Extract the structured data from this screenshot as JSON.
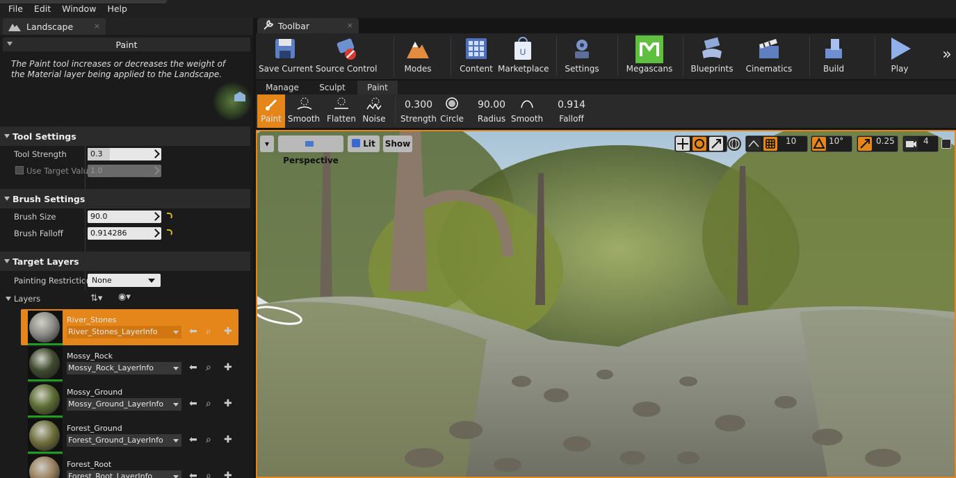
{
  "menu": {
    "items": [
      "File",
      "Edit",
      "Window",
      "Help"
    ]
  },
  "landscape_tab": {
    "label": "Landscape",
    "close": "×"
  },
  "paint_panel": {
    "title": "Paint",
    "description": "The Paint tool increases or decreases the weight of the Material layer being applied to the Landscape."
  },
  "tool_settings": {
    "title": "Tool Settings",
    "strength_label": "Tool Strength",
    "strength_value": "0.3",
    "strength_fraction": 0.3,
    "use_target_label": "Use Target Value",
    "use_target_value": "1.0"
  },
  "brush_settings": {
    "title": "Brush Settings",
    "size_label": "Brush Size",
    "size_value": "90.0",
    "falloff_label": "Brush Falloff",
    "falloff_value": "0.914286"
  },
  "target_layers": {
    "title": "Target Layers",
    "restriction_label": "Painting Restriction",
    "restriction_value": "None",
    "layers_label": "Layers",
    "layers": [
      {
        "name": "River_Stones",
        "info": "River_Stones_LayerInfo",
        "selected": true,
        "color": "#8c8c86"
      },
      {
        "name": "Mossy_Rock",
        "info": "Mossy_Rock_LayerInfo",
        "selected": false,
        "color": "#3f4a2e"
      },
      {
        "name": "Mossy_Ground",
        "info": "Mossy_Ground_LayerInfo",
        "selected": false,
        "color": "#5b6d33"
      },
      {
        "name": "Forest_Ground",
        "info": "Forest_Ground_LayerInfo",
        "selected": false,
        "color": "#6e6e3c"
      },
      {
        "name": "Forest_Root",
        "info": "Forest_Root_LayerInfo",
        "selected": false,
        "color": "#9a8060"
      }
    ]
  },
  "toolbar_tab": {
    "label": "Toolbar",
    "close": "×"
  },
  "toolbar": {
    "save_current": "Save Current",
    "source_control": "Source Control",
    "modes": "Modes",
    "content": "Content",
    "marketplace": "Marketplace",
    "settings": "Settings",
    "megascans": "Megascans",
    "blueprints": "Blueprints",
    "cinematics": "Cinematics",
    "build": "Build",
    "play": "Play",
    "more": "»"
  },
  "mode_tabs": {
    "manage": "Manage",
    "sculpt": "Sculpt",
    "paint": "Paint"
  },
  "paint_tools": {
    "paint": "Paint",
    "smooth": "Smooth",
    "flatten": "Flatten",
    "noise": "Noise",
    "strength_value": "0.300",
    "strength_label": "Strength",
    "circle": "Circle",
    "radius_value": "90.00",
    "radius_label": "Radius",
    "smooth_falloff": "Smooth",
    "falloff_value": "0.914",
    "falloff_label": "Falloff"
  },
  "viewport": {
    "perspective": "Perspective",
    "lit": "Lit",
    "show": "Show",
    "grid_snap": "10",
    "rot_snap": "10°",
    "scale_snap": "0.25",
    "cam_speed": "4"
  },
  "colors": {
    "accent": "#e4861a",
    "panel": "#232323",
    "snap_active": "#e4861a"
  }
}
